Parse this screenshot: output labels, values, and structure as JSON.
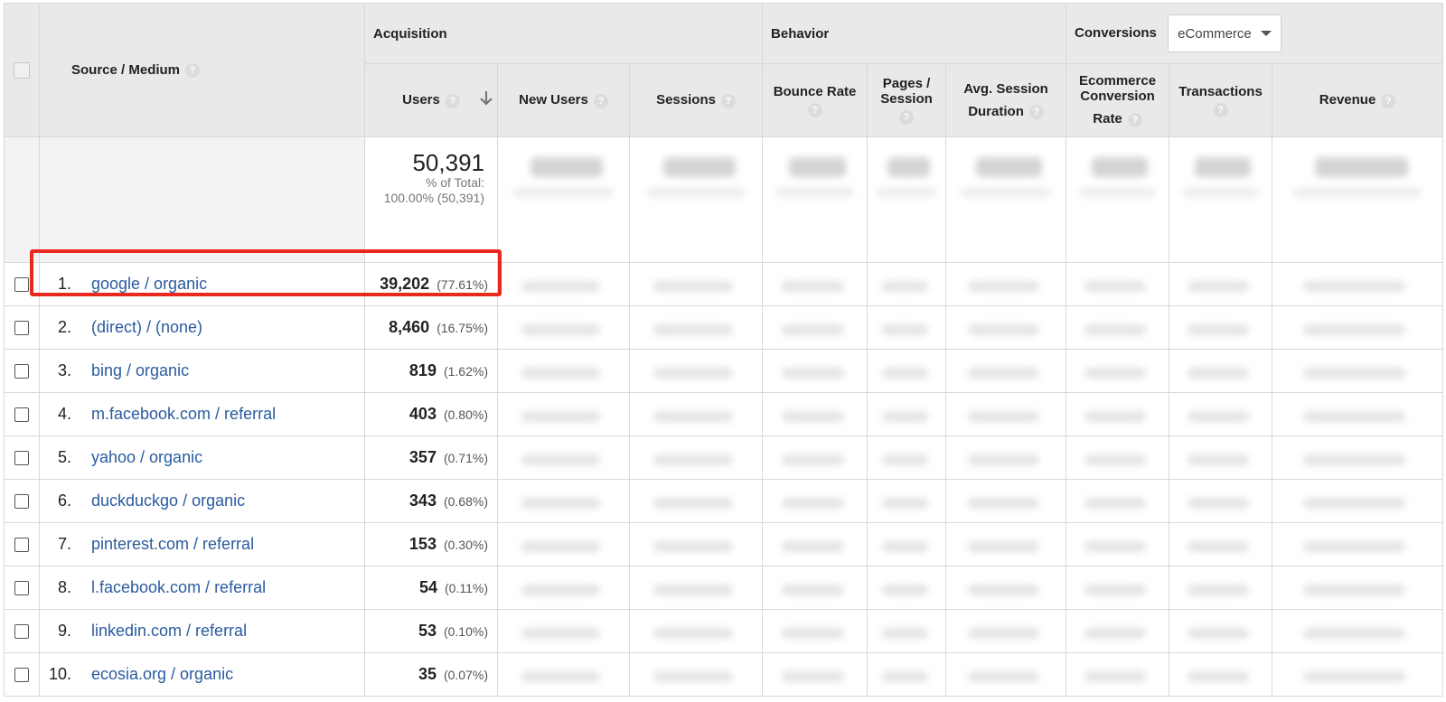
{
  "header": {
    "source_medium": "Source / Medium",
    "acquisition": "Acquisition",
    "behavior": "Behavior",
    "conversions": "Conversions",
    "conversions_select": "eCommerce",
    "help_glyph": "?",
    "columns": {
      "users": "Users",
      "new_users": "New Users",
      "sessions": "Sessions",
      "bounce_rate": "Bounce Rate",
      "pages_session_1": "Pages /",
      "pages_session_2": "Session",
      "avg_session_1": "Avg. Session",
      "avg_session_2": "Duration",
      "ecom_1": "Ecommerce",
      "ecom_2": "Conversion",
      "ecom_3": "Rate",
      "transactions": "Transactions",
      "revenue": "Revenue"
    }
  },
  "summary": {
    "users_total": "50,391",
    "pct_label": "% of Total:",
    "pct_value": "100.00% (50,391)"
  },
  "rows": [
    {
      "index": "1.",
      "source": "google / organic",
      "users": "39,202",
      "pct": "(77.61%)"
    },
    {
      "index": "2.",
      "source": "(direct) / (none)",
      "users": "8,460",
      "pct": "(16.75%)"
    },
    {
      "index": "3.",
      "source": "bing / organic",
      "users": "819",
      "pct": "(1.62%)"
    },
    {
      "index": "4.",
      "source": "m.facebook.com / referral",
      "users": "403",
      "pct": "(0.80%)"
    },
    {
      "index": "5.",
      "source": "yahoo / organic",
      "users": "357",
      "pct": "(0.71%)"
    },
    {
      "index": "6.",
      "source": "duckduckgo / organic",
      "users": "343",
      "pct": "(0.68%)"
    },
    {
      "index": "7.",
      "source": "pinterest.com / referral",
      "users": "153",
      "pct": "(0.30%)"
    },
    {
      "index": "8.",
      "source": "l.facebook.com / referral",
      "users": "54",
      "pct": "(0.11%)"
    },
    {
      "index": "9.",
      "source": "linkedin.com / referral",
      "users": "53",
      "pct": "(0.10%)"
    },
    {
      "index": "10.",
      "source": "ecosia.org / organic",
      "users": "35",
      "pct": "(0.07%)"
    }
  ],
  "colors": {
    "link": "#2a5b9f",
    "highlight": "#e8291f",
    "header_bg": "#e9e9e9"
  }
}
